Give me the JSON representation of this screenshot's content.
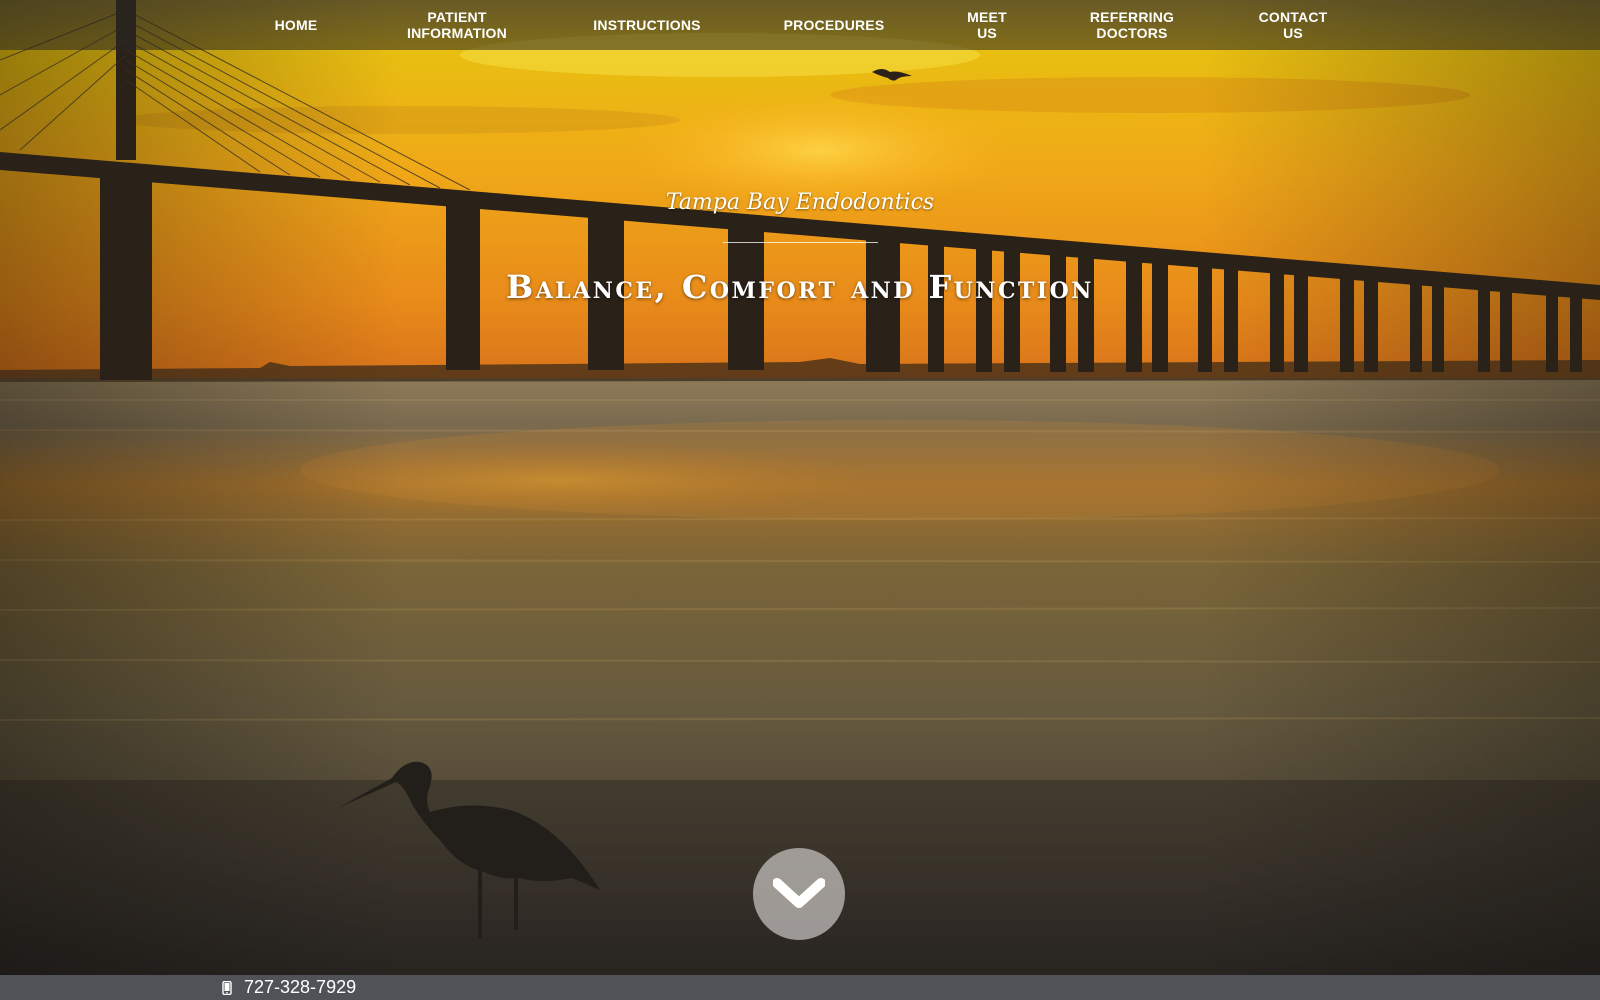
{
  "nav": {
    "items": [
      {
        "label": "HOME"
      },
      {
        "label": "PATIENT\nINFORMATION"
      },
      {
        "label": "INSTRUCTIONS"
      },
      {
        "label": "PROCEDURES"
      },
      {
        "label": "MEET\nUS"
      },
      {
        "label": "REFERRING\nDOCTORS"
      },
      {
        "label": "CONTACT\nUS"
      }
    ]
  },
  "hero": {
    "brand": "Tampa Bay Endodontics",
    "tagline": "Balance, Comfort and Function",
    "scroll_icon": "chevron-down-icon"
  },
  "footer_bar": {
    "phone": "727-328-7929",
    "phone_icon": "mobile-phone-icon"
  },
  "colors": {
    "sky_top": "#e8b400",
    "sky_horizon": "#e07f10",
    "water_dark": "#3a332a",
    "nav_bg": "#3b3730",
    "bottom_bar": "#4f5358",
    "text": "#ffffff"
  }
}
